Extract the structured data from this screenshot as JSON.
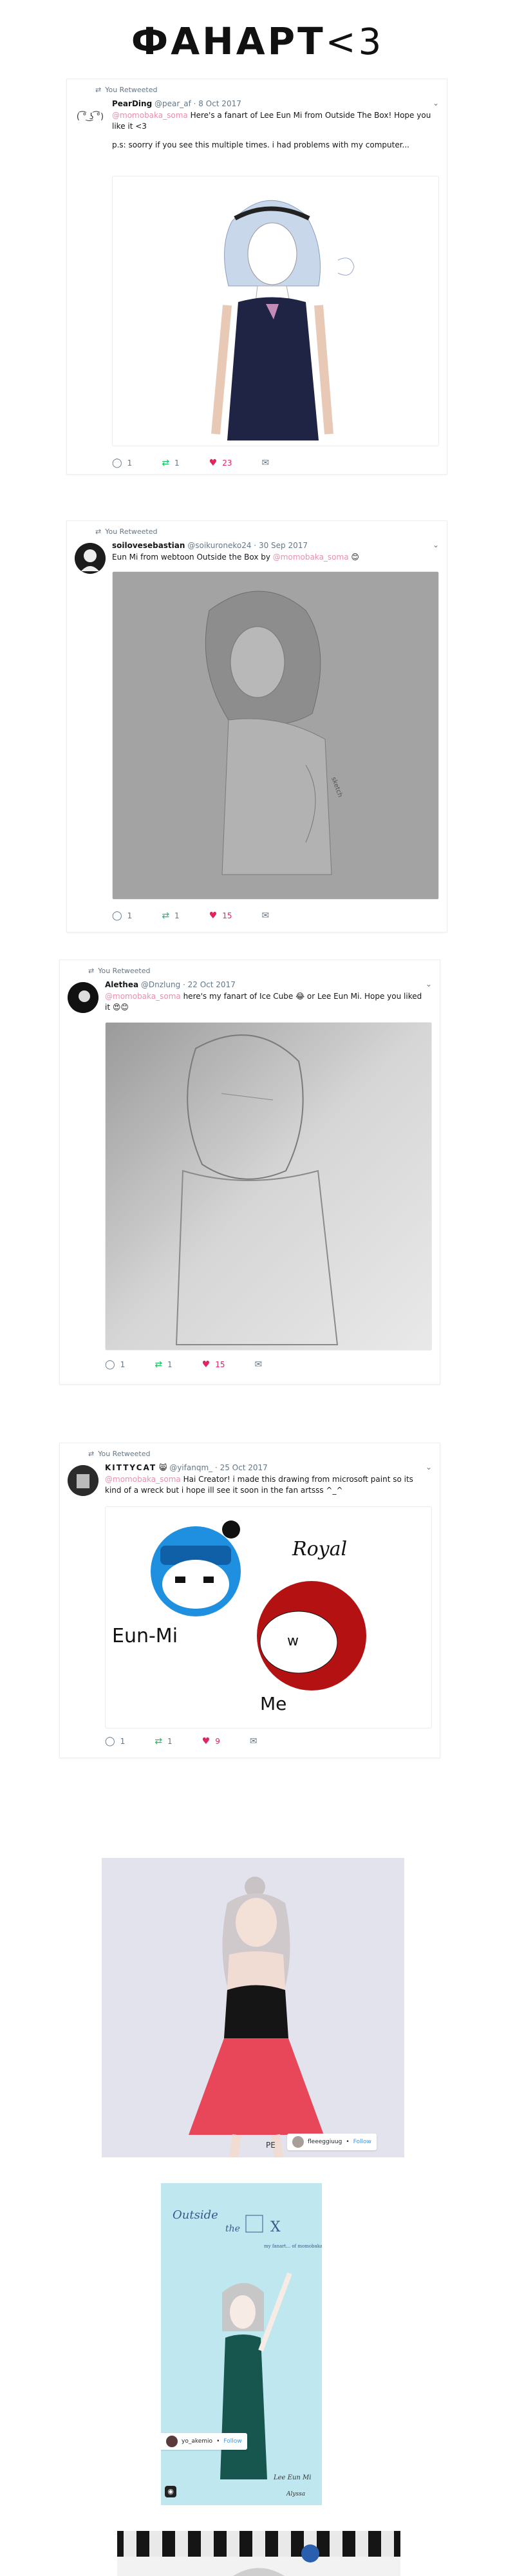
{
  "page": {
    "title": "ФАНАРТ",
    "title_suffix": "<3"
  },
  "tweets": [
    {
      "retweet_label": "You Retweeted",
      "name": "PearDing",
      "meta": "@pear_af · 8 Oct 2017",
      "mention": "@momobaka_soma",
      "text": " Here's a fanart of Lee Eun Mi from Outside The Box! Hope you like it <3",
      "text2": "p.s: soorry if you see this multiple times. i had problems with my computer...",
      "replies": "1",
      "retweets": "1",
      "likes": "23"
    },
    {
      "retweet_label": "You Retweeted",
      "name": "soilovesebastian",
      "meta": "@soikuroneko24 · 30 Sep 2017",
      "text": "Eun Mi from webtoon Outside the Box by ",
      "mention": "@momobaka_soma",
      "emoji": "😊",
      "replies": "1",
      "retweets": "1",
      "likes": "15"
    },
    {
      "retweet_label": "You Retweeted",
      "name": "Alethea",
      "meta": "@Dnzlung · 22 Oct 2017",
      "mention": "@momobaka_soma",
      "text": " here's my fanart of Ice Cube 😂 or Lee Eun Mi. Hope you liked it 😍😊",
      "replies": "1",
      "retweets": "1",
      "likes": "15"
    },
    {
      "retweet_label": "You Retweeted",
      "name": "KITTYCAT",
      "name_emoji": "😸",
      "meta": "@yifanqm_ · 25 Oct 2017",
      "mention": "@momobaka_soma",
      "text": " Hai Creator! i made this drawing from microsoft paint so its kind of a wreck but i hope ill see it soon in the fan artsss ^_^",
      "drawing_labels": [
        "Royal",
        "Eun-Mi",
        "Me"
      ],
      "replies": "1",
      "retweets": "1",
      "likes": "9"
    }
  ],
  "instagram": [
    {
      "username": "fleeeggiuug",
      "follow": "Follow"
    },
    {
      "username": "yo_akemio",
      "follow": "Follow"
    }
  ],
  "art5_label": "PE",
  "art6_text": {
    "outside": "Outside",
    "the": "the",
    "box": "X",
    "note": "my fanart... of momobaka_soma",
    "eunmi": "Lee Eun Mi",
    "sign": "Alyssa"
  },
  "icons": {
    "reply": "reply-icon",
    "retweet": "retweet-icon",
    "like": "heart-icon",
    "dm": "envelope-icon"
  },
  "colors": {
    "mention": "#e88fb0",
    "retweet": "#17bf63",
    "like": "#e0245e",
    "muted": "#657786"
  }
}
